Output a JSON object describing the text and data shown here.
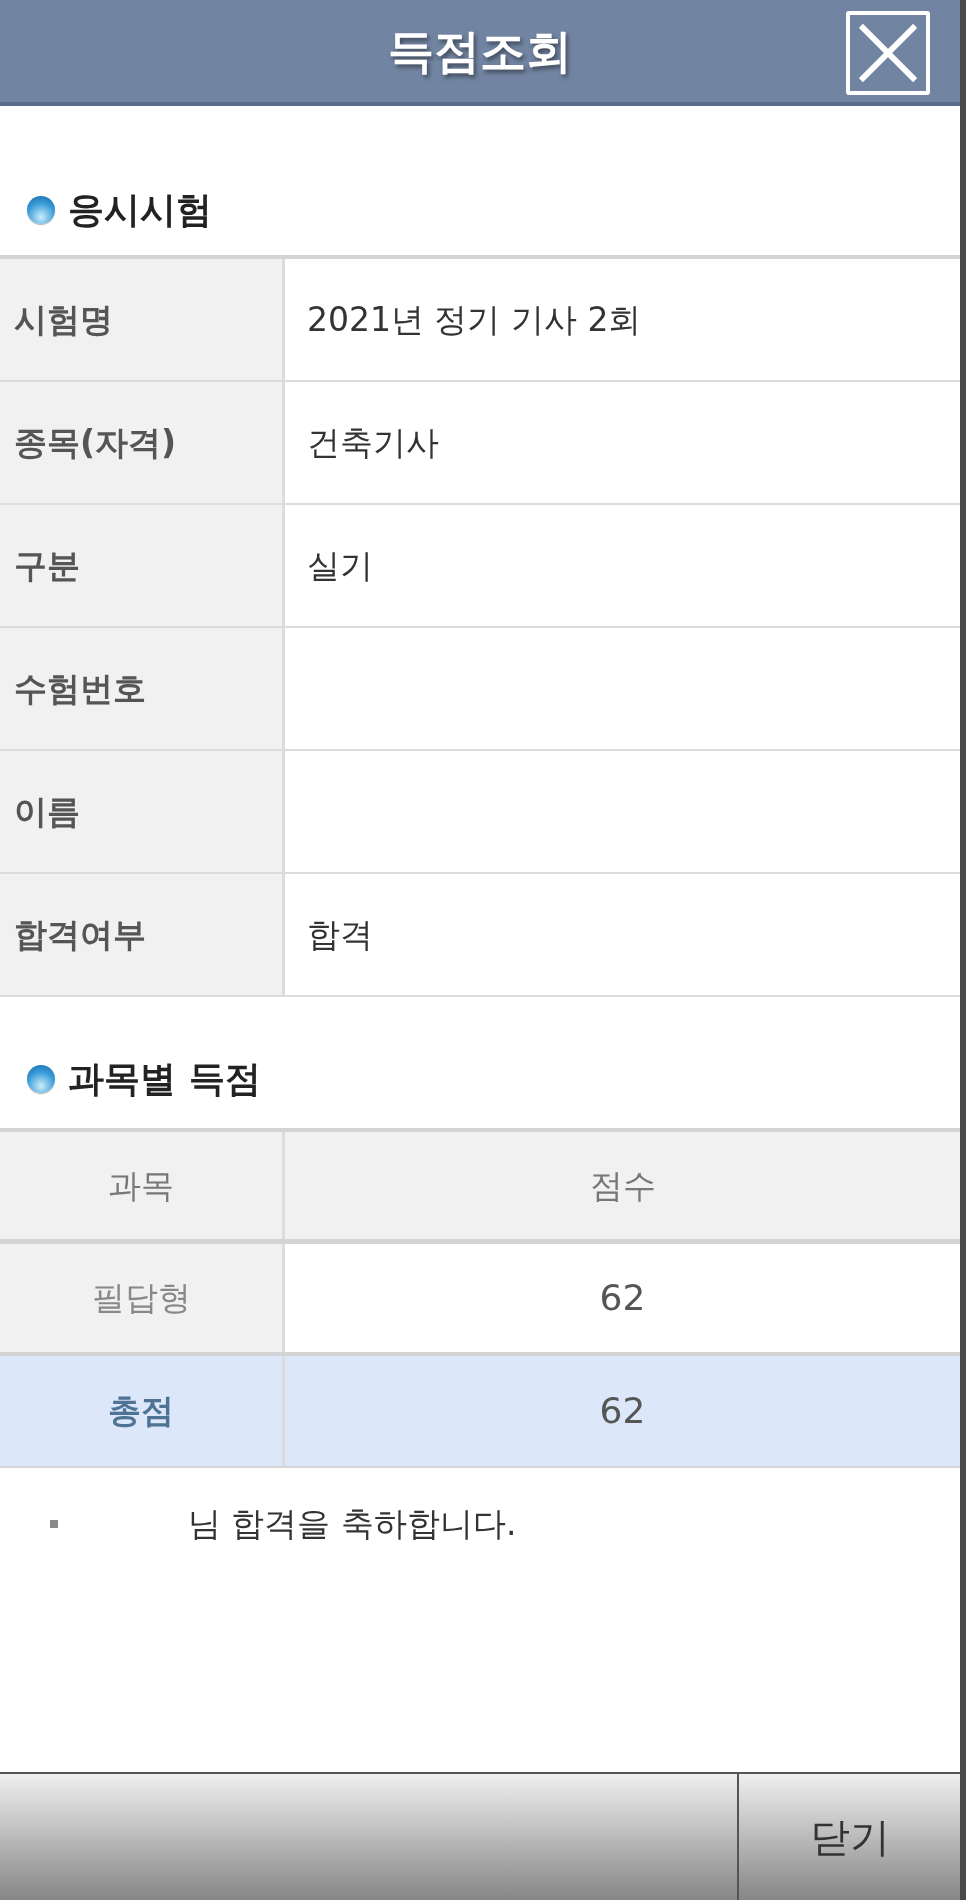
{
  "window": {
    "title": "득점조회"
  },
  "exam_section": {
    "title": "응시시험",
    "rows": [
      {
        "label": "시험명",
        "value": "2021년 정기 기사 2회"
      },
      {
        "label": "종목(자격)",
        "value": "건축기사"
      },
      {
        "label": "구분",
        "value": "실기"
      },
      {
        "label": "수험번호"
      },
      {
        "label": "이름"
      },
      {
        "label": "합격여부",
        "value": "합격"
      }
    ]
  },
  "score_section": {
    "title": "과목별 득점",
    "columns": [
      "과목",
      "점수"
    ],
    "rows": [
      {
        "kind": "subject",
        "subject": "필답형",
        "score": "62"
      },
      {
        "kind": "total",
        "subject": "총점",
        "score": "62"
      }
    ]
  },
  "message": "님 합격을 축하합니다.",
  "footer": {
    "buttons": [
      "닫기"
    ]
  }
}
